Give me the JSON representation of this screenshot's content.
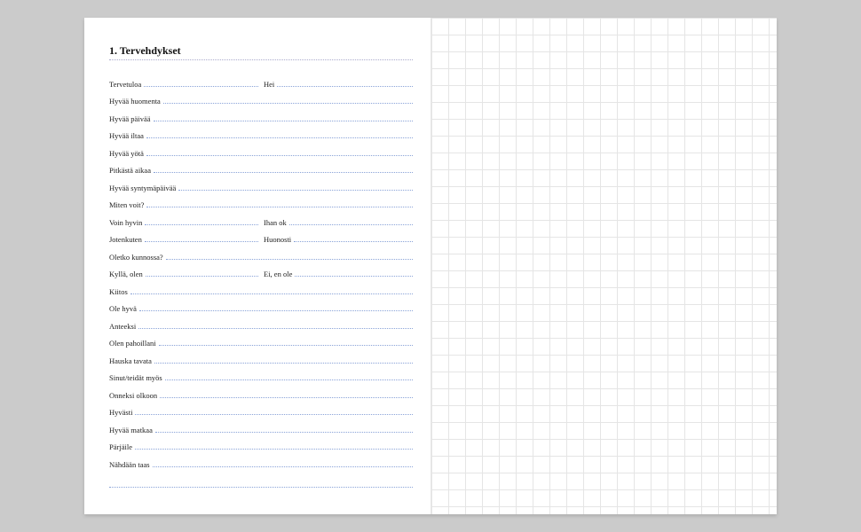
{
  "heading": "1. Tervehdykset",
  "rows": [
    {
      "cells": [
        "Tervetuloa",
        "Hei"
      ]
    },
    {
      "cells": [
        "Hyvää huomenta"
      ]
    },
    {
      "cells": [
        "Hyvää päivää"
      ]
    },
    {
      "cells": [
        "Hyvää iltaa"
      ]
    },
    {
      "cells": [
        "Hyvää yötä"
      ]
    },
    {
      "cells": [
        "Pitkästä aikaa"
      ]
    },
    {
      "cells": [
        "Hyvää syntymäpäivää"
      ]
    },
    {
      "cells": [
        "Miten voit?"
      ]
    },
    {
      "cells": [
        "Voin hyvin",
        "Ihan ok"
      ]
    },
    {
      "cells": [
        "Jotenkuten",
        "Huonosti"
      ]
    },
    {
      "cells": [
        "Oletko kunnossa?"
      ]
    },
    {
      "cells": [
        "Kyllä, olen",
        "Ei, en ole"
      ]
    },
    {
      "cells": [
        "Kiitos"
      ]
    },
    {
      "cells": [
        "Ole hyvä"
      ]
    },
    {
      "cells": [
        "Anteeksi"
      ]
    },
    {
      "cells": [
        "Olen pahoillani"
      ]
    },
    {
      "cells": [
        "Hauska tavata"
      ]
    },
    {
      "cells": [
        "Sinut/teidät myös"
      ]
    },
    {
      "cells": [
        "Onneksi olkoon"
      ]
    },
    {
      "cells": [
        "Hyvästi"
      ]
    },
    {
      "cells": [
        "Hyvää matkaa"
      ]
    },
    {
      "cells": [
        "Pärjäile"
      ]
    },
    {
      "cells": [
        "Nähdään taas"
      ]
    }
  ]
}
